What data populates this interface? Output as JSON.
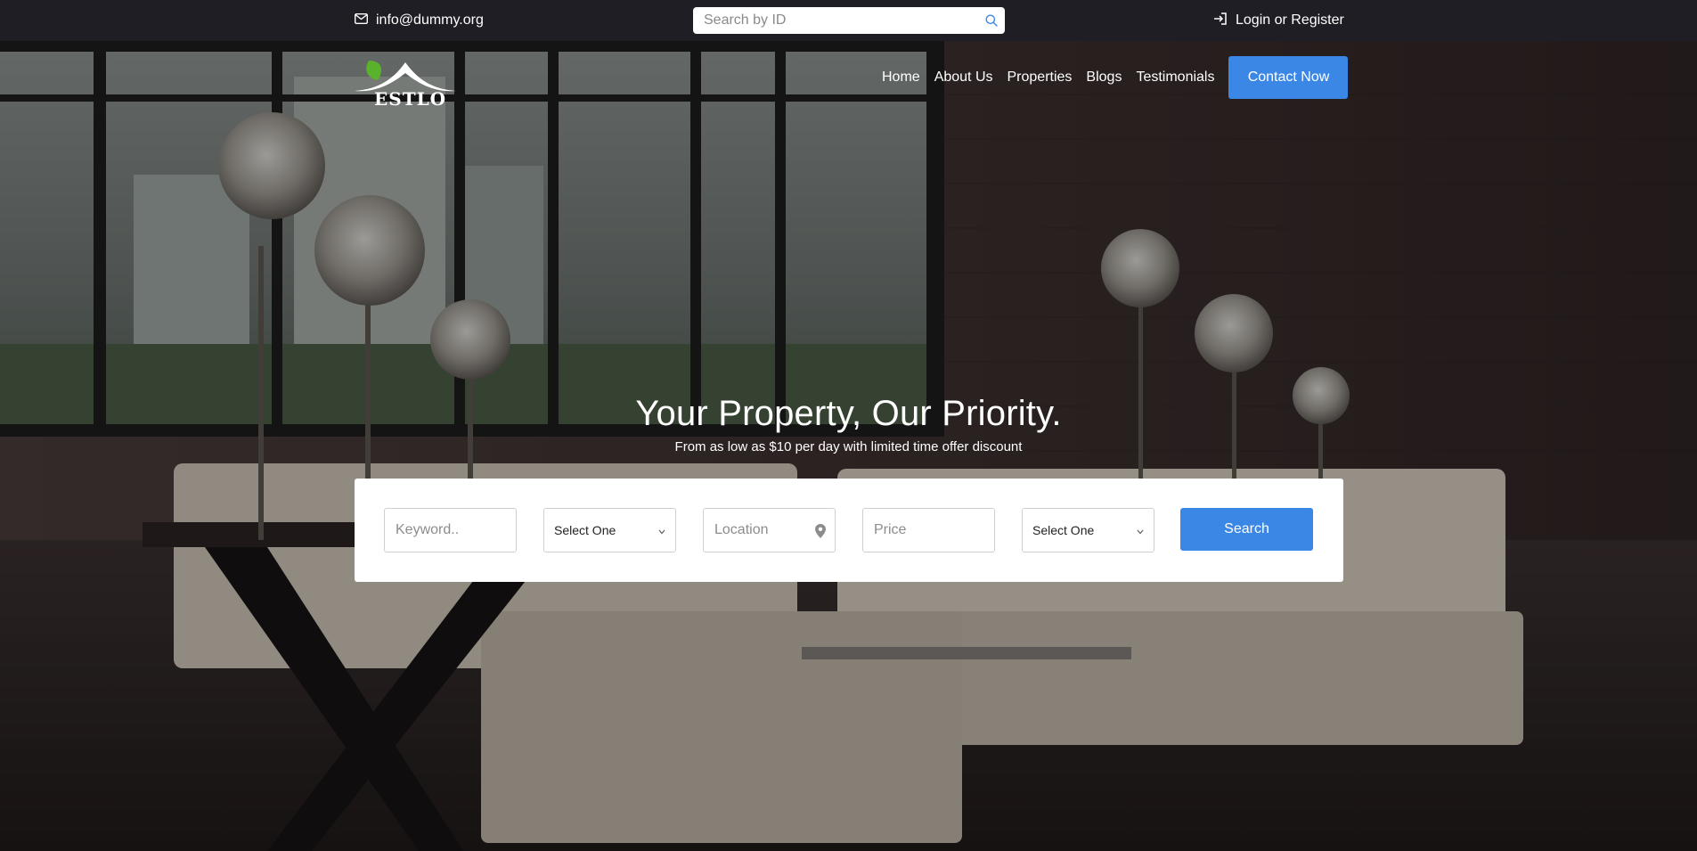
{
  "topbar": {
    "email": "info@dummy.org",
    "search_placeholder": "Search by ID",
    "login_label": "Login or Register"
  },
  "header": {
    "logo_text": "ESTLO",
    "nav": [
      "Home",
      "About Us",
      "Properties",
      "Blogs",
      "Testimonials"
    ],
    "cta_label": "Contact Now"
  },
  "hero": {
    "title": "Your Property, Our Priority.",
    "subtitle": "From as low as $10 per day with limited time offer discount"
  },
  "search_form": {
    "keyword_placeholder": "Keyword..",
    "select_one_a": "Select One",
    "location_placeholder": "Location",
    "price_placeholder": "Price",
    "select_one_b": "Select One",
    "search_label": "Search"
  },
  "colors": {
    "accent": "#3b87e6",
    "topbar_bg": "#1e1e24",
    "logo_leaf": "#5ab22c"
  }
}
